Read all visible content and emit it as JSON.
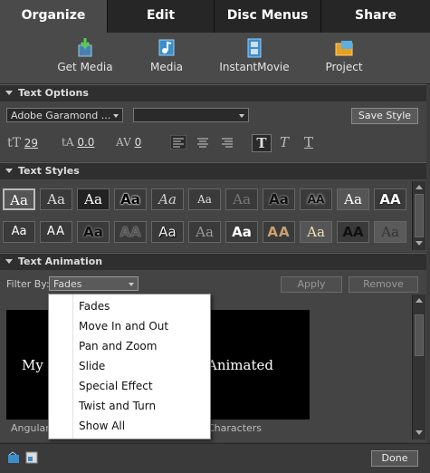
{
  "tabs": [
    "Organize",
    "Edit",
    "Disc Menus",
    "Share"
  ],
  "toolbar": {
    "items": [
      {
        "label": "Get Media",
        "icon": "get-media-icon"
      },
      {
        "label": "Media",
        "icon": "media-icon"
      },
      {
        "label": "InstantMovie",
        "icon": "film-icon"
      },
      {
        "label": "Project",
        "icon": "project-icon"
      }
    ]
  },
  "text_options": {
    "header": "Text Options",
    "font_family": "Adobe Garamond ...",
    "font_style": "",
    "save_style": "Save Style",
    "font_size": "29",
    "leading": "0.0",
    "kerning": "0"
  },
  "text_styles": {
    "header": "Text Styles",
    "row1": [
      "Aa",
      "Aa",
      "Aa",
      "Aa",
      "Aa",
      "Aa",
      "Aa",
      "Aa",
      "AA",
      "Aa",
      "AA"
    ],
    "row2": [
      "Aa",
      "AA",
      "Aa",
      "AA",
      "Aa",
      "Aa",
      "Aa",
      "AA",
      "Aa",
      "AA",
      "Aa"
    ]
  },
  "text_animation": {
    "header": "Text Animation",
    "filter_label": "Filter By:",
    "filter_value": "Fades",
    "apply": "Apply",
    "remove": "Remove",
    "preview_left": "My",
    "preview_right": "Animated",
    "caption_left": "Angular",
    "caption_right": "Characters"
  },
  "filter_menu": [
    "Fades",
    "Move In and Out",
    "Pan and Zoom",
    "Slide",
    "Special Effect",
    "Twist and Turn",
    "Show All"
  ],
  "bottom": {
    "done": "Done"
  },
  "colors": {
    "tab_active": "#4a4a4a",
    "panel": "#444444",
    "preview_bg": "#000000",
    "menu_bg": "#ffffff"
  }
}
